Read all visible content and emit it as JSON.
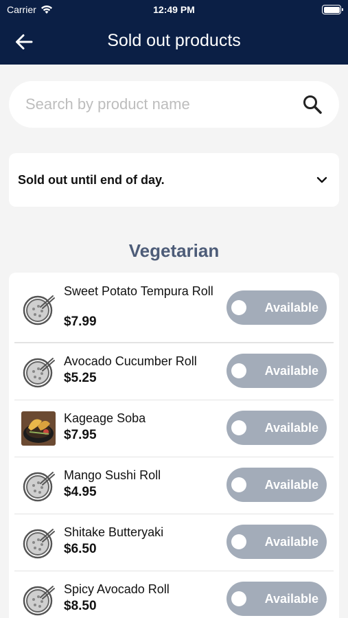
{
  "status_bar": {
    "carrier": "Carrier",
    "time": "12:49 PM"
  },
  "nav": {
    "title": "Sold out products",
    "back_icon": "arrow-left-icon"
  },
  "search": {
    "placeholder": "Search by product name",
    "value": "",
    "icon": "search-icon"
  },
  "filter": {
    "selected": "Sold out until end of day.",
    "icon": "chevron-down-icon"
  },
  "section": {
    "title": "Vegetarian"
  },
  "products": [
    {
      "name": " Sweet Potato Tempura Roll",
      "price": "$7.99",
      "status": "Available",
      "image": "placeholder-bowl-icon"
    },
    {
      "name": "Avocado Cucumber Roll",
      "price": "$5.25",
      "status": "Available",
      "image": "placeholder-bowl-icon"
    },
    {
      "name": "Kageage Soba",
      "price": "$7.95",
      "status": "Available",
      "image": "food-photo"
    },
    {
      "name": "Mango Sushi Roll",
      "price": "$4.95",
      "status": "Available",
      "image": "placeholder-bowl-icon"
    },
    {
      "name": "Shitake Butteryaki",
      "price": "$6.50",
      "status": "Available",
      "image": "placeholder-bowl-icon"
    },
    {
      "name": "Spicy Avocado Roll",
      "price": "$8.50",
      "status": "Available",
      "image": "placeholder-bowl-icon"
    }
  ],
  "colors": {
    "nav_bg": "#0b1f45",
    "section_title": "#4d5c78",
    "toggle_off": "#a3acb9",
    "page_bg": "#f4f4f4"
  }
}
